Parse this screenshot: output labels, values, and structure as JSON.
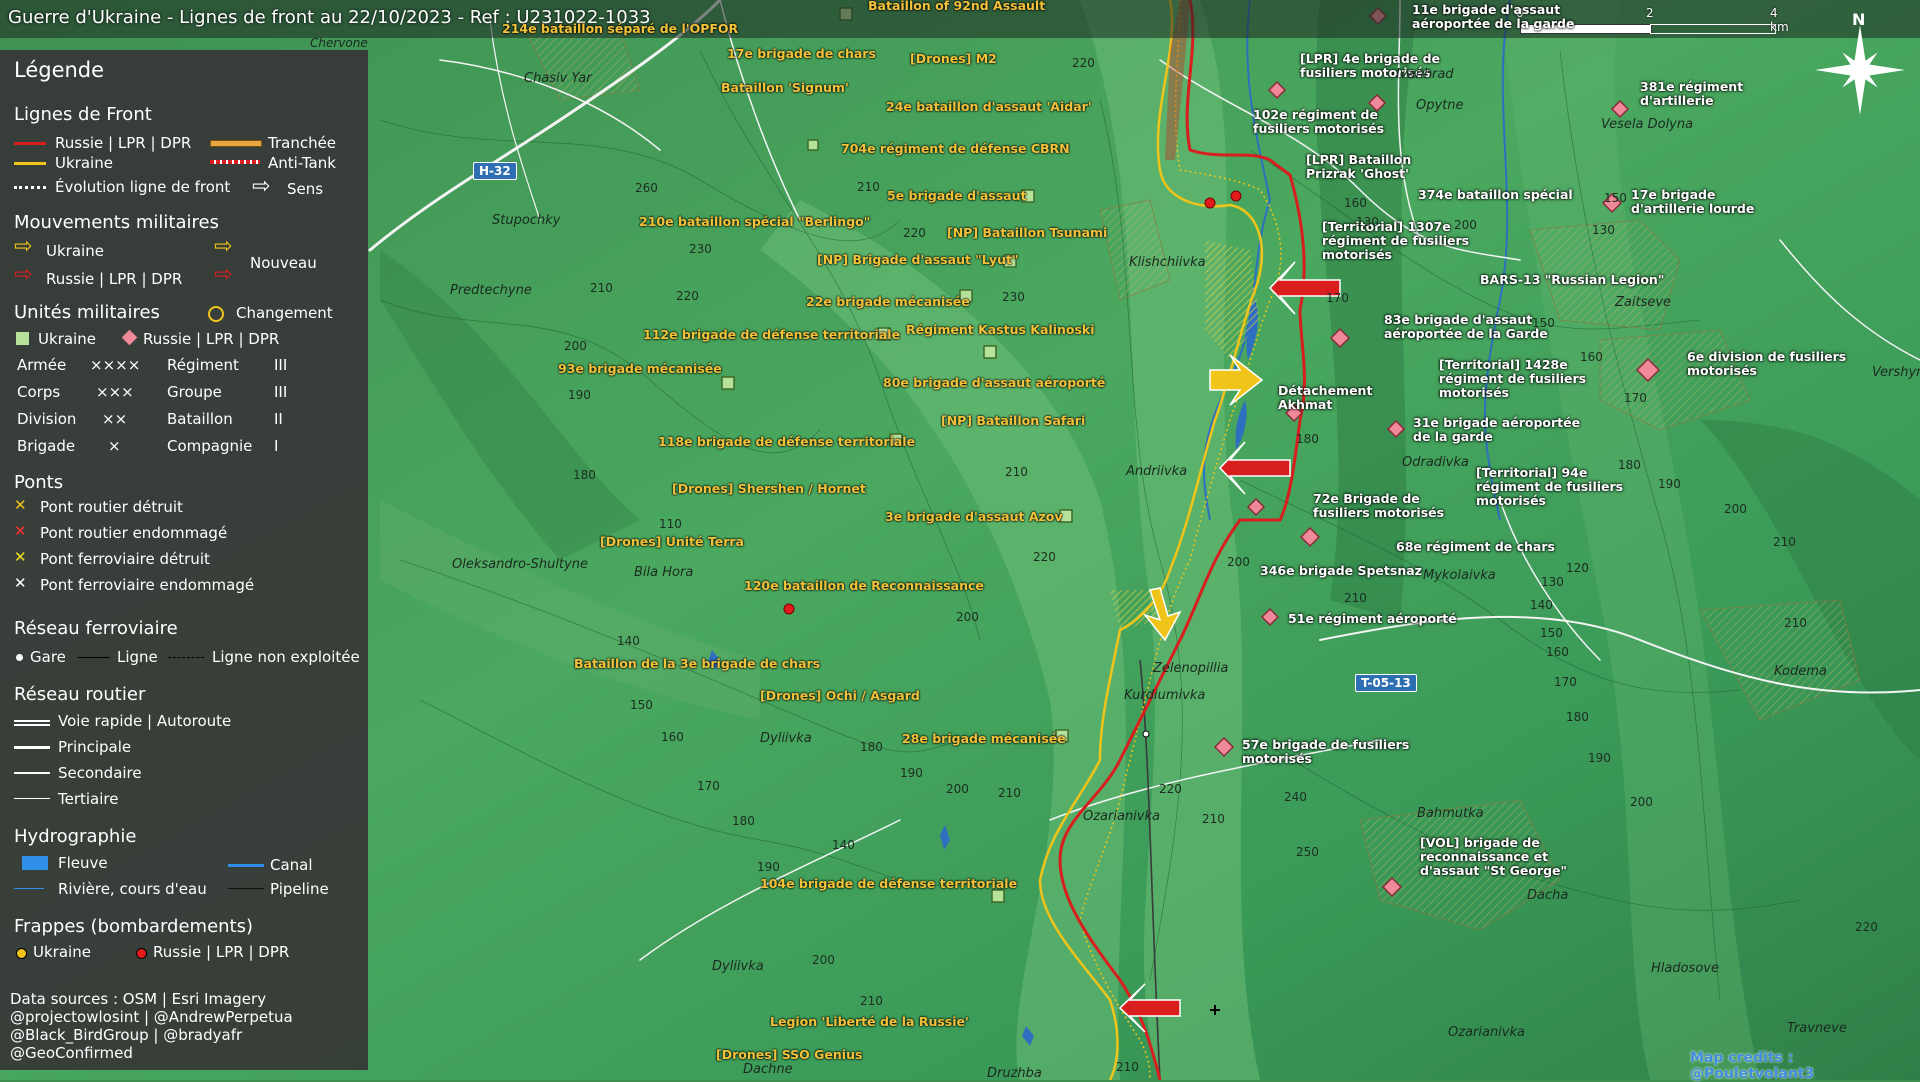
{
  "header": {
    "title": "Guerre d'Ukraine - Lignes de front au 22/10/2023 - Ref : U231022-1033",
    "scale": [
      "0",
      "2",
      "4 km"
    ],
    "north": "N"
  },
  "colors": {
    "russia": "#d81e1e",
    "ukraine": "#f0c419",
    "tranchee": "#e8a640",
    "water": "#2f6fbf"
  },
  "legend": {
    "title": "Légende",
    "front": {
      "heading": "Lignes de Front",
      "russia": "Russie | LPR | DPR",
      "ukraine": "Ukraine",
      "tranchee": "Tranchée",
      "antitank": "Anti-Tank",
      "evolution": "Évolution ligne de front",
      "sens": "Sens"
    },
    "mouvements": {
      "heading": "Mouvements militaires",
      "ukraine": "Ukraine",
      "russia": "Russie | LPR | DPR",
      "nouveau": "Nouveau"
    },
    "unites": {
      "heading": "Unités militaires",
      "changement": "Changement",
      "ukraine": "Ukraine",
      "russia": "Russie | LPR | DPR",
      "rows": [
        {
          "a": "Armée",
          "as": "××××",
          "b": "Régiment",
          "bs": "III"
        },
        {
          "a": "Corps",
          "as": "×××",
          "b": "Groupe",
          "bs": "III"
        },
        {
          "a": "Division",
          "as": "××",
          "b": "Bataillon",
          "bs": "II"
        },
        {
          "a": "Brigade",
          "as": "×",
          "b": "Compagnie",
          "bs": "I"
        }
      ]
    },
    "ponts": {
      "heading": "Ponts",
      "items": [
        "Pont routier détruit",
        "Pont routier endommagé",
        "Pont ferroviaire détruit",
        "Pont ferroviaire endommagé"
      ]
    },
    "ferro": {
      "heading": "Réseau ferroviaire",
      "gare": "Gare",
      "ligne": "Ligne",
      "non": "Ligne non exploitée"
    },
    "routier": {
      "heading": "Réseau routier",
      "items": [
        "Voie rapide | Autoroute",
        "Principale",
        "Secondaire",
        "Tertiaire"
      ]
    },
    "hydro": {
      "heading": "Hydrographie",
      "fleuve": "Fleuve",
      "canal": "Canal",
      "riviere": "Rivière, cours d'eau",
      "pipeline": "Pipeline"
    },
    "frappes": {
      "heading": "Frappes (bombardements)",
      "ukraine": "Ukraine",
      "russia": "Russie | LPR | DPR"
    },
    "credits": [
      "Data sources : OSM | Esri Imagery",
      "@projectowlosint | @AndrewPerpetua",
      "@Black_BirdGroup | @bradyafr",
      "@GeoConfirmed"
    ]
  },
  "map_credit": "Map credits : @Pouletvolant3",
  "ukraine_units": [
    "214e bataillon séparé de l'OPFOR",
    "17e brigade de chars",
    "[Drones] M2",
    "Bataillon 'Signum'",
    "24e bataillon d'assaut 'Aidar'",
    "704e régiment de défense CBRN",
    "5e brigade d'assaut",
    "210e bataillon spécial \"Berlingo\"",
    "[NP] Bataillon Tsunami",
    "[NP] Brigade d'assaut \"Lyut\"",
    "22e brigade mécanisée",
    "112e brigade de défense territoriale",
    "Régiment Kastus Kalinoski",
    "93e brigade mécanisée",
    "80e brigade d'assaut aéroporté",
    "[NP] Bataillon Safari",
    "118e brigade de défense territoriale",
    "[Drones] Shershen / Hornet",
    "3e brigade d'assaut Azov",
    "[Drones] Unité Terra",
    "120e bataillon de Reconnaissance",
    "Bataillon de la 3e brigade de chars",
    "[Drones] Ochi / Asgard",
    "28e brigade mécanisée",
    "104e brigade de défense territoriale",
    "Legion 'Liberté de la Russie'",
    "[Drones] SSO Genius",
    "Bataillon of 92nd Assault"
  ],
  "russia_units": [
    "11e brigade d'assaut aéroportée de la garde",
    "[LPR] 4e brigade de fusiliers motorisés",
    "381e régiment d'artillerie",
    "102e régiment de fusiliers motorisés",
    "[LPR] Bataillon Prizrak 'Ghost'",
    "374e bataillon spécial",
    "17e brigade d'artillerie lourde",
    "[Territorial] 1307e régiment de fusiliers motorisés",
    "BARS-13 \"Russian Legion\"",
    "83e brigade d'assaut aéroportée de la Garde",
    "6e division de fusiliers motorisés",
    "[Territorial] 1428e régiment de fusiliers motorisés",
    "Détachement Akhmat",
    "31e brigade aéroportée de la garde",
    "[Territorial] 94e régiment de fusiliers motorisés",
    "72e Brigade de fusiliers motorisés",
    "68e régiment de chars",
    "346e brigade Spetsnaz",
    "51e régiment aéroporté",
    "57e brigade de fusiliers motorisés",
    "[VOL] brigade de reconnaissance et d'assaut \"St George\""
  ],
  "places": [
    "Chasiv Yar",
    "Chervone",
    "Stupochky",
    "Predtechyne",
    "Klishchiivka",
    "Andriivka",
    "Oleksandro-Shultyne",
    "Bila Hora",
    "Zelenopillia",
    "Kurdiumivka",
    "Dyliivka",
    "Ozarianivka",
    "Ivanhrad",
    "Opytne",
    "Vesela Dolyna",
    "Zaitseve",
    "Odradivka",
    "Mykolaivka",
    "Kodema",
    "Bahmutka",
    "Dacha",
    "Hladosove",
    "Travneve",
    "Druzhba",
    "Dachne",
    "Vershyna"
  ],
  "roads": [
    "H-32",
    "T-05-13"
  ],
  "elevations": [
    "220",
    "260",
    "210",
    "230",
    "220",
    "210",
    "200",
    "190",
    "180",
    "170",
    "160",
    "150",
    "140",
    "110",
    "120",
    "240",
    "250",
    "130"
  ]
}
